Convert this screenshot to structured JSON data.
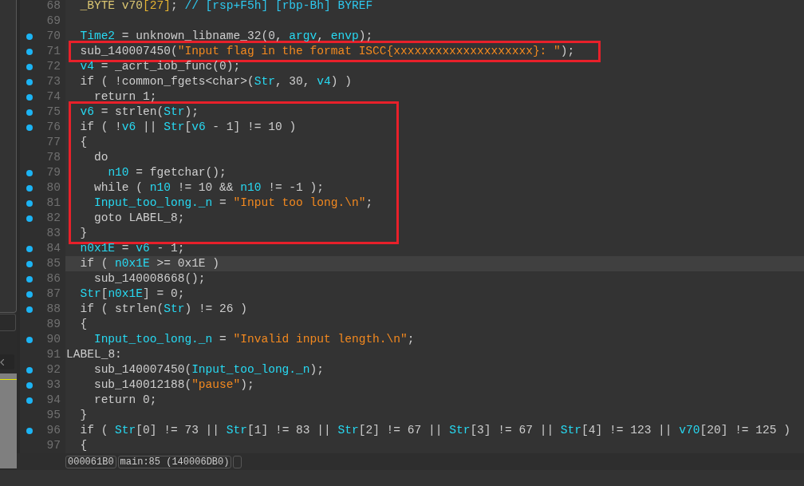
{
  "code_view": {
    "segments": [
      {
        "kind": "plain",
        "lines": [
          {
            "number": "68",
            "dot": false,
            "selected": false,
            "tokens": [
              {
                "kind": "decl",
                "text": "  _BYTE v70"
              },
              {
                "kind": "size",
                "text": "[27]"
              },
              {
                "kind": "plain",
                "text": ";"
              },
              {
                "kind": "comment",
                "text": " // [rsp+F5h] [rbp-Bh] BYREF"
              }
            ]
          },
          {
            "number": "69",
            "dot": false,
            "selected": false
          },
          {
            "number": "70",
            "dot": true,
            "selected": false,
            "tokens": [
              {
                "kind": "var",
                "text": "  Time2"
              },
              {
                "kind": "plain",
                "text": " = unknown_libname_32(0, "
              },
              {
                "kind": "var",
                "text": "argv"
              },
              {
                "kind": "plain",
                "text": ", "
              },
              {
                "kind": "var",
                "text": "envp"
              },
              {
                "kind": "plain",
                "text": ");"
              }
            ]
          }
        ]
      },
      {
        "kind": "boxed",
        "lines": [
          {
            "number": "71",
            "dot": true,
            "selected": false,
            "tokens": [
              {
                "kind": "plain",
                "text": "  sub_140007450("
              },
              {
                "kind": "str",
                "text": "\"Input flag in the format ISCC{xxxxxxxxxxxxxxxxxxxx}: \""
              },
              {
                "kind": "plain",
                "text": ");"
              }
            ]
          }
        ]
      },
      {
        "kind": "plain",
        "lines": [
          {
            "number": "72",
            "dot": true,
            "selected": false,
            "tokens": [
              {
                "kind": "var",
                "text": "  v4"
              },
              {
                "kind": "plain",
                "text": " = _acrt_iob_func(0);"
              }
            ]
          },
          {
            "number": "73",
            "dot": true,
            "selected": false,
            "tokens": [
              {
                "kind": "plain",
                "text": "  if ( !common_fgets<char>("
              },
              {
                "kind": "var",
                "text": "Str"
              },
              {
                "kind": "plain",
                "text": ", 30, "
              },
              {
                "kind": "var",
                "text": "v4"
              },
              {
                "kind": "plain",
                "text": ") )"
              }
            ]
          },
          {
            "number": "74",
            "dot": true,
            "selected": false,
            "tokens": [
              {
                "kind": "plain",
                "text": "    return 1;"
              }
            ]
          }
        ]
      },
      {
        "kind": "boxed",
        "lines": [
          {
            "number": "75",
            "dot": true,
            "selected": false,
            "tokens": [
              {
                "kind": "var",
                "text": "  v6"
              },
              {
                "kind": "plain",
                "text": " = strlen("
              },
              {
                "kind": "var",
                "text": "Str"
              },
              {
                "kind": "plain",
                "text": ");"
              }
            ]
          },
          {
            "number": "76",
            "dot": true,
            "selected": false,
            "tokens": [
              {
                "kind": "plain",
                "text": "  if ( !"
              },
              {
                "kind": "var",
                "text": "v6"
              },
              {
                "kind": "plain",
                "text": " || "
              },
              {
                "kind": "var",
                "text": "Str"
              },
              {
                "kind": "plain",
                "text": "["
              },
              {
                "kind": "var",
                "text": "v6"
              },
              {
                "kind": "plain",
                "text": " - 1] != 10 )"
              }
            ]
          },
          {
            "number": "77",
            "dot": false,
            "selected": false,
            "tokens": [
              {
                "kind": "plain",
                "text": "  {"
              }
            ]
          },
          {
            "number": "78",
            "dot": false,
            "selected": false,
            "tokens": [
              {
                "kind": "plain",
                "text": "    do"
              }
            ]
          },
          {
            "number": "79",
            "dot": true,
            "selected": false,
            "tokens": [
              {
                "kind": "var",
                "text": "      n10"
              },
              {
                "kind": "plain",
                "text": " = fgetchar();"
              }
            ]
          },
          {
            "number": "80",
            "dot": true,
            "selected": false,
            "tokens": [
              {
                "kind": "plain",
                "text": "    while ( "
              },
              {
                "kind": "var",
                "text": "n10"
              },
              {
                "kind": "plain",
                "text": " != 10 && "
              },
              {
                "kind": "var",
                "text": "n10"
              },
              {
                "kind": "plain",
                "text": " != -1 );"
              }
            ]
          },
          {
            "number": "81",
            "dot": true,
            "selected": false,
            "tokens": [
              {
                "kind": "var",
                "text": "    Input_too_long._n"
              },
              {
                "kind": "plain",
                "text": " = "
              },
              {
                "kind": "str",
                "text": "\"Input too long.\\n\""
              },
              {
                "kind": "plain",
                "text": ";"
              }
            ]
          },
          {
            "number": "82",
            "dot": true,
            "selected": false,
            "tokens": [
              {
                "kind": "plain",
                "text": "    goto LABEL_8;"
              }
            ]
          },
          {
            "number": "83",
            "dot": false,
            "selected": false,
            "tokens": [
              {
                "kind": "plain",
                "text": "  }"
              }
            ]
          }
        ]
      },
      {
        "kind": "plain",
        "lines": [
          {
            "number": "84",
            "dot": true,
            "selected": false,
            "tokens": [
              {
                "kind": "var",
                "text": "  n0x1E"
              },
              {
                "kind": "plain",
                "text": " = "
              },
              {
                "kind": "var",
                "text": "v6"
              },
              {
                "kind": "plain",
                "text": " - 1;"
              }
            ]
          },
          {
            "number": "85",
            "dot": true,
            "selected": true,
            "tokens": [
              {
                "kind": "plain",
                "text": "  if ( "
              },
              {
                "kind": "var",
                "text": "n0x1E"
              },
              {
                "kind": "plain",
                "text": " >= 0x1E )"
              }
            ]
          },
          {
            "number": "86",
            "dot": true,
            "selected": false,
            "tokens": [
              {
                "kind": "plain",
                "text": "    sub_140008668();"
              }
            ]
          },
          {
            "number": "87",
            "dot": true,
            "selected": false,
            "tokens": [
              {
                "kind": "var",
                "text": "  Str"
              },
              {
                "kind": "plain",
                "text": "["
              },
              {
                "kind": "var",
                "text": "n0x1E"
              },
              {
                "kind": "plain",
                "text": "] = 0;"
              }
            ]
          },
          {
            "number": "88",
            "dot": true,
            "selected": false,
            "tokens": [
              {
                "kind": "plain",
                "text": "  if ( strlen("
              },
              {
                "kind": "var",
                "text": "Str"
              },
              {
                "kind": "plain",
                "text": ") != 26 )"
              }
            ]
          },
          {
            "number": "89",
            "dot": false,
            "selected": false,
            "tokens": [
              {
                "kind": "plain",
                "text": "  {"
              }
            ]
          },
          {
            "number": "90",
            "dot": true,
            "selected": false,
            "tokens": [
              {
                "kind": "var",
                "text": "    Input_too_long._n"
              },
              {
                "kind": "plain",
                "text": " = "
              },
              {
                "kind": "str",
                "text": "\"Invalid input length.\\n\""
              },
              {
                "kind": "plain",
                "text": ";"
              }
            ]
          },
          {
            "number": "91",
            "dot": false,
            "selected": false,
            "tokens": [
              {
                "kind": "plain",
                "text": "LABEL_8:"
              }
            ]
          },
          {
            "number": "92",
            "dot": true,
            "selected": false,
            "tokens": [
              {
                "kind": "plain",
                "text": "    sub_140007450("
              },
              {
                "kind": "var",
                "text": "Input_too_long._n"
              },
              {
                "kind": "plain",
                "text": ");"
              }
            ]
          },
          {
            "number": "93",
            "dot": true,
            "selected": false,
            "tokens": [
              {
                "kind": "plain",
                "text": "    sub_140012188("
              },
              {
                "kind": "str",
                "text": "\"pause\""
              },
              {
                "kind": "plain",
                "text": ");"
              }
            ]
          },
          {
            "number": "94",
            "dot": true,
            "selected": false,
            "tokens": [
              {
                "kind": "plain",
                "text": "    return 0;"
              }
            ]
          },
          {
            "number": "95",
            "dot": false,
            "selected": false,
            "tokens": [
              {
                "kind": "plain",
                "text": "  }"
              }
            ]
          },
          {
            "number": "96",
            "dot": true,
            "selected": false,
            "tokens": [
              {
                "kind": "plain",
                "text": "  if ( "
              },
              {
                "kind": "var",
                "text": "Str"
              },
              {
                "kind": "plain",
                "text": "[0] != 73 || "
              },
              {
                "kind": "var",
                "text": "Str"
              },
              {
                "kind": "plain",
                "text": "[1] != 83 || "
              },
              {
                "kind": "var",
                "text": "Str"
              },
              {
                "kind": "plain",
                "text": "[2] != 67 || "
              },
              {
                "kind": "var",
                "text": "Str"
              },
              {
                "kind": "plain",
                "text": "[3] != 67 || "
              },
              {
                "kind": "var",
                "text": "Str"
              },
              {
                "kind": "plain",
                "text": "[4] != 123 || "
              },
              {
                "kind": "var",
                "text": "v70"
              },
              {
                "kind": "plain",
                "text": "[20] != 125 )"
              }
            ]
          },
          {
            "number": "97",
            "dot": false,
            "selected": false,
            "tokens": [
              {
                "kind": "plain",
                "text": "  {"
              }
            ]
          }
        ]
      }
    ]
  },
  "status_bar": {
    "fields": [
      "000061B0",
      "main:85 (140006DB0)"
    ]
  }
}
